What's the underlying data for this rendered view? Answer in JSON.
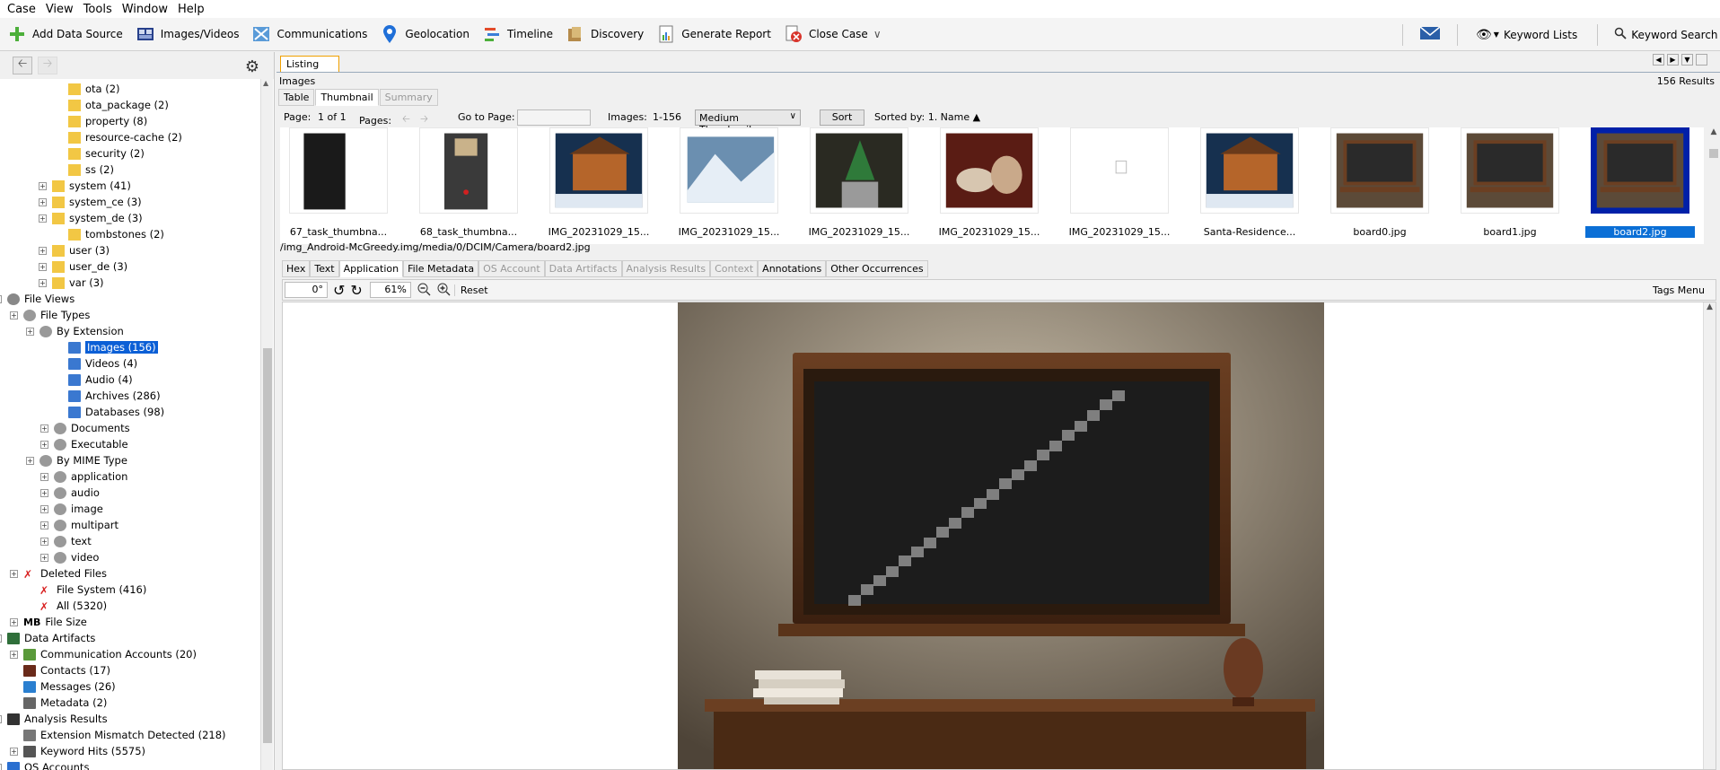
{
  "menu": [
    "Case",
    "View",
    "Tools",
    "Window",
    "Help"
  ],
  "toolbar": {
    "items": [
      {
        "label": "Add Data Source",
        "icon": "plus-icon"
      },
      {
        "label": "Images/Videos",
        "icon": "images-icon"
      },
      {
        "label": "Communications",
        "icon": "communications-icon"
      },
      {
        "label": "Geolocation",
        "icon": "geolocation-pin-icon"
      },
      {
        "label": "Timeline",
        "icon": "timeline-icon"
      },
      {
        "label": "Discovery",
        "icon": "discovery-icon"
      },
      {
        "label": "Generate Report",
        "icon": "report-icon"
      },
      {
        "label": "Close Case",
        "icon": "close-case-icon"
      }
    ],
    "keyword_lists": "Keyword Lists",
    "keyword_search": "Keyword Search"
  },
  "tree": {
    "items": [
      {
        "label": "ota (2)",
        "type": "folder"
      },
      {
        "label": "ota_package (2)",
        "type": "folder"
      },
      {
        "label": "property (8)",
        "type": "folder"
      },
      {
        "label": "resource-cache (2)",
        "type": "folder"
      },
      {
        "label": "security (2)",
        "type": "folder"
      },
      {
        "label": "ss (2)",
        "type": "folder"
      },
      {
        "label": "system (41)",
        "type": "folder",
        "exp": true
      },
      {
        "label": "system_ce (3)",
        "type": "folder",
        "exp": true
      },
      {
        "label": "system_de (3)",
        "type": "folder",
        "exp": true
      },
      {
        "label": "tombstones (2)",
        "type": "folder"
      },
      {
        "label": "user (3)",
        "type": "folder",
        "exp": true
      },
      {
        "label": "user_de (3)",
        "type": "folder",
        "exp": true
      },
      {
        "label": "var (3)",
        "type": "folder",
        "exp": true
      },
      {
        "label": "File Views",
        "type": "views",
        "exp": true
      },
      {
        "label": "File Types",
        "type": "types",
        "exp": true
      },
      {
        "label": "By Extension",
        "type": "types",
        "exp": true
      },
      {
        "label": "Images (156)",
        "type": "doc",
        "selected": true
      },
      {
        "label": "Videos (4)",
        "type": "doc"
      },
      {
        "label": "Audio (4)",
        "type": "doc"
      },
      {
        "label": "Archives (286)",
        "type": "doc"
      },
      {
        "label": "Databases (98)",
        "type": "doc"
      },
      {
        "label": "Documents",
        "type": "types",
        "exp": true
      },
      {
        "label": "Executable",
        "type": "types",
        "exp": true
      },
      {
        "label": "By MIME Type",
        "type": "types",
        "exp": true
      },
      {
        "label": "application",
        "type": "types",
        "exp": true
      },
      {
        "label": "audio",
        "type": "types",
        "exp": true
      },
      {
        "label": "image",
        "type": "types",
        "exp": true
      },
      {
        "label": "multipart",
        "type": "types",
        "exp": true
      },
      {
        "label": "text",
        "type": "types",
        "exp": true
      },
      {
        "label": "video",
        "type": "types",
        "exp": true
      },
      {
        "label": "Deleted Files",
        "type": "deleted",
        "exp": true
      },
      {
        "label": "File System (416)",
        "type": "deleted"
      },
      {
        "label": "All (5320)",
        "type": "deleted"
      },
      {
        "label": "File Size",
        "type": "mb",
        "exp": true
      },
      {
        "label": "Data Artifacts",
        "type": "artifacts",
        "exp": true
      },
      {
        "label": "Communication Accounts (20)",
        "type": "comm",
        "exp": true
      },
      {
        "label": "Contacts (17)",
        "type": "contacts"
      },
      {
        "label": "Messages (26)",
        "type": "messages"
      },
      {
        "label": "Metadata (2)",
        "type": "metadata"
      },
      {
        "label": "Analysis Results",
        "type": "analysis",
        "exp": true
      },
      {
        "label": "Extension Mismatch Detected (218)",
        "type": "mismatch"
      },
      {
        "label": "Keyword Hits (5575)",
        "type": "keyword",
        "exp": true
      },
      {
        "label": "OS Accounts",
        "type": "os",
        "exp": true
      }
    ],
    "mb_prefix": "MB"
  },
  "listing": {
    "tab": "Listing",
    "title": "Images",
    "results": "156  Results",
    "subtabs": [
      "Table",
      "Thumbnail",
      "Summary"
    ],
    "page_label": "Page:",
    "page_value": "1 of 1",
    "pages_label": "Pages:",
    "goto_label": "Go to Page:",
    "images_label": "Images:",
    "images_range": "1-156",
    "thumb_size": "Medium Thumbnails",
    "sort_btn": "Sort",
    "sorted_by": "Sorted by: 1. Name ▲"
  },
  "thumbnails": [
    {
      "name": "67_task_thumbna...",
      "kind": "black"
    },
    {
      "name": "68_task_thumbna...",
      "kind": "phone"
    },
    {
      "name": "IMG_20231029_15...",
      "kind": "house"
    },
    {
      "name": "IMG_20231029_15...",
      "kind": "mountain"
    },
    {
      "name": "IMG_20231029_15...",
      "kind": "tree"
    },
    {
      "name": "IMG_20231029_15...",
      "kind": "tea"
    },
    {
      "name": "IMG_20231029_15...",
      "kind": "blank"
    },
    {
      "name": "Santa-Residence...",
      "kind": "house"
    },
    {
      "name": "board0.jpg",
      "kind": "board"
    },
    {
      "name": "board1.jpg",
      "kind": "board"
    },
    {
      "name": "board2.jpg",
      "kind": "board",
      "selected": true
    }
  ],
  "file_path": "/img_Android-McGreedy.img/media/0/DCIM/Camera/board2.jpg",
  "content_tabs": [
    {
      "label": "Hex"
    },
    {
      "label": "Text"
    },
    {
      "label": "Application",
      "active": true
    },
    {
      "label": "File Metadata"
    },
    {
      "label": "OS Account",
      "disabled": true
    },
    {
      "label": "Data Artifacts",
      "disabled": true
    },
    {
      "label": "Analysis Results",
      "disabled": true
    },
    {
      "label": "Context",
      "disabled": true
    },
    {
      "label": "Annotations"
    },
    {
      "label": "Other Occurrences"
    }
  ],
  "viewer": {
    "rotation": "0°",
    "zoom": "61%",
    "reset": "Reset",
    "tags_menu": "Tags Menu"
  },
  "colors": {
    "selection": "#0b5fd6",
    "accent_orange": "#f0a000"
  }
}
